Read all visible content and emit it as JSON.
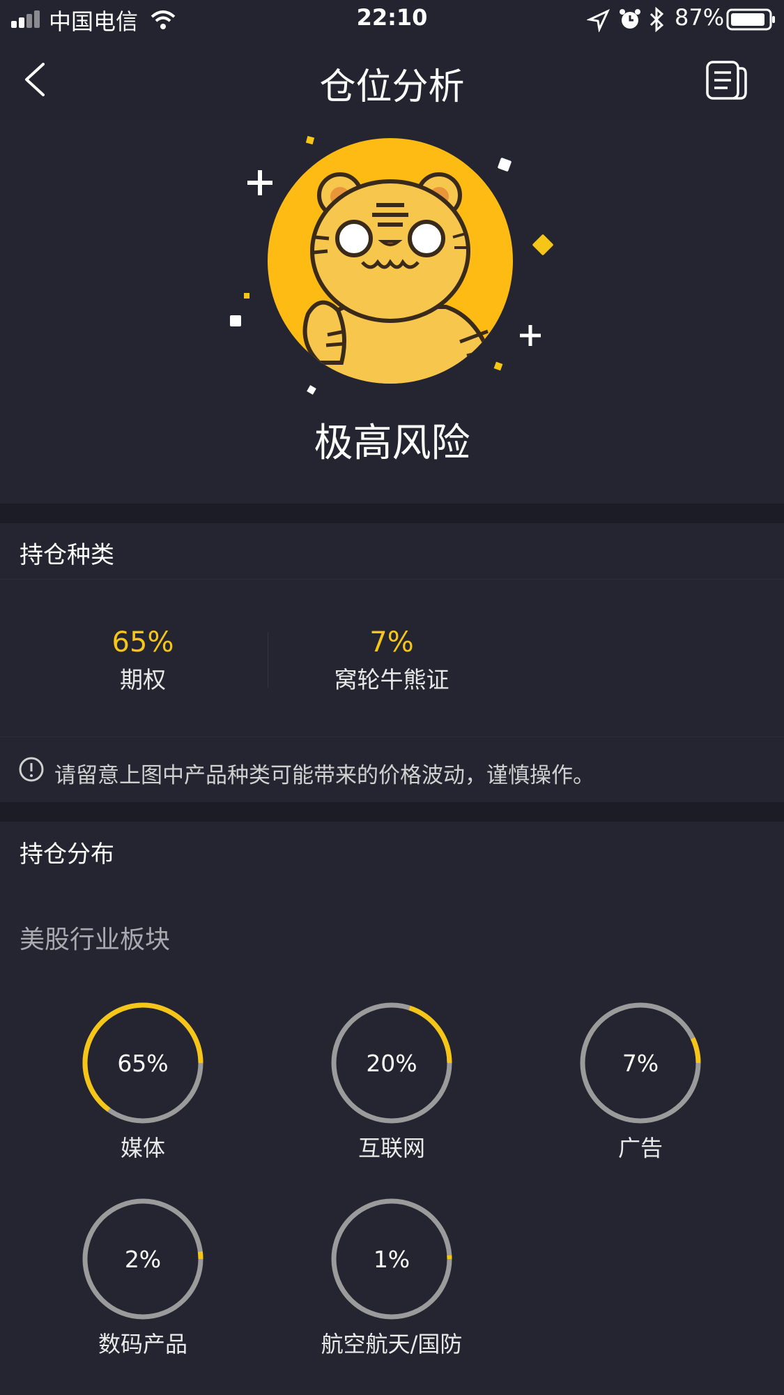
{
  "status_bar": {
    "carrier": "中国电信",
    "time": "22:10",
    "battery": "87%"
  },
  "nav": {
    "title": "仓位分析",
    "back_icon": "chevron-left-icon",
    "doc_icon": "document-icon"
  },
  "hero": {
    "mascot": "tiger-mascot",
    "risk_label": "极高风险"
  },
  "holding_types": {
    "title": "持仓种类",
    "items": [
      {
        "value": "65%",
        "label": "期权"
      },
      {
        "value": "7%",
        "label": "窝轮牛熊证"
      }
    ],
    "notice": "请留意上图中产品种类可能带来的价格波动，谨慎操作。"
  },
  "distribution": {
    "title": "持仓分布",
    "subtitle": "美股行业板块",
    "sectors": [
      {
        "pct_text": "65%",
        "label": "媒体",
        "fraction": 0.65
      },
      {
        "pct_text": "20%",
        "label": "互联网",
        "fraction": 0.2
      },
      {
        "pct_text": "7%",
        "label": "广告",
        "fraction": 0.07
      },
      {
        "pct_text": "2%",
        "label": "数码产品",
        "fraction": 0.02
      },
      {
        "pct_text": "1%",
        "label": "航空航天/国防",
        "fraction": 0.01
      }
    ]
  },
  "colors": {
    "accent": "#f5c518",
    "track": "#9b9b9b",
    "background": "#242530"
  }
}
